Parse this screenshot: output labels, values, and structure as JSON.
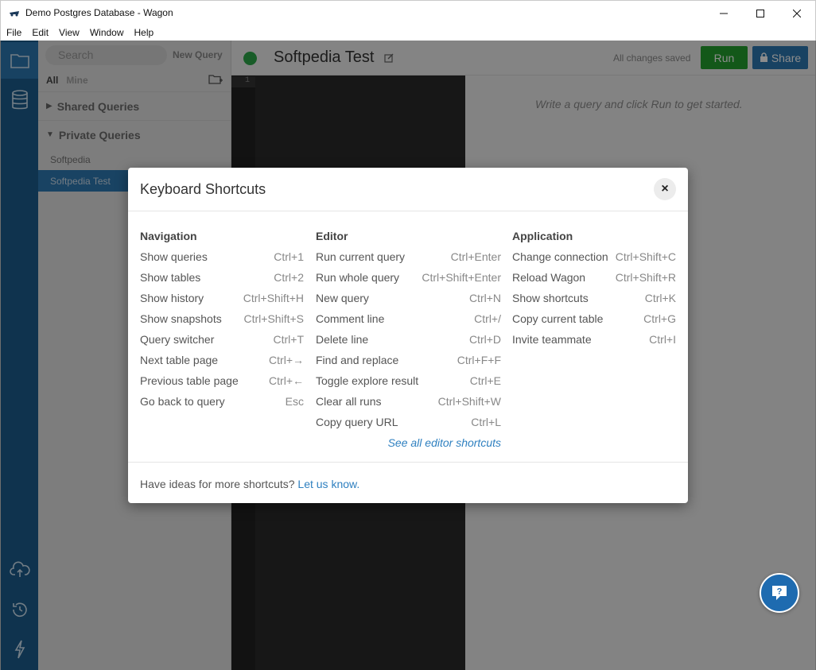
{
  "window": {
    "title": "Demo Postgres Database - Wagon"
  },
  "menu": [
    "File",
    "Edit",
    "View",
    "Window",
    "Help"
  ],
  "sidebar": {
    "search_placeholder": "Search",
    "new_query": "New Query",
    "filter_all": "All",
    "filter_mine": "Mine",
    "groups": [
      {
        "label": "Shared Queries",
        "expanded": false
      },
      {
        "label": "Private Queries",
        "expanded": true
      }
    ],
    "queries": [
      {
        "label": "Softpedia",
        "selected": false
      },
      {
        "label": "Softpedia Test",
        "selected": true
      }
    ]
  },
  "header": {
    "query_title": "Softpedia Test",
    "saved_status": "All changes saved",
    "run_label": "Run",
    "share_label": "Share",
    "status_color": "#2da84a"
  },
  "editor": {
    "line_number": "1"
  },
  "results": {
    "hint": "Write a query and click Run to get started."
  },
  "modal": {
    "title": "Keyboard Shortcuts",
    "close_label": "×",
    "navigation": {
      "title": "Navigation",
      "items": [
        {
          "label": "Show queries",
          "keys": "Ctrl+1"
        },
        {
          "label": "Show tables",
          "keys": "Ctrl+2"
        },
        {
          "label": "Show history",
          "keys": "Ctrl+Shift+H"
        },
        {
          "label": "Show snapshots",
          "keys": "Ctrl+Shift+S"
        },
        {
          "label": "Query switcher",
          "keys": "Ctrl+T"
        },
        {
          "label": "Next table page",
          "keys": "Ctrl+→"
        },
        {
          "label": "Previous table page",
          "keys": "Ctrl+←"
        },
        {
          "label": "Go back to query",
          "keys": "Esc"
        }
      ]
    },
    "editor": {
      "title": "Editor",
      "items": [
        {
          "label": "Run current query",
          "keys": "Ctrl+Enter"
        },
        {
          "label": "Run whole query",
          "keys": "Ctrl+Shift+Enter"
        },
        {
          "label": "New query",
          "keys": "Ctrl+N"
        },
        {
          "label": "Comment line",
          "keys": "Ctrl+/"
        },
        {
          "label": "Delete line",
          "keys": "Ctrl+D"
        },
        {
          "label": "Find and replace",
          "keys": "Ctrl+F+F"
        },
        {
          "label": "Toggle explore result",
          "keys": "Ctrl+E"
        },
        {
          "label": "Clear all runs",
          "keys": "Ctrl+Shift+W"
        },
        {
          "label": "Copy query URL",
          "keys": "Ctrl+L"
        }
      ],
      "see_all": "See all editor shortcuts"
    },
    "application": {
      "title": "Application",
      "items": [
        {
          "label": "Change connection",
          "keys": "Ctrl+Shift+C"
        },
        {
          "label": "Reload Wagon",
          "keys": "Ctrl+Shift+R"
        },
        {
          "label": "Show shortcuts",
          "keys": "Ctrl+K"
        },
        {
          "label": "Copy current table",
          "keys": "Ctrl+G"
        },
        {
          "label": "Invite teammate",
          "keys": "Ctrl+I"
        }
      ]
    },
    "footer_text": "Have ideas for more shortcuts?",
    "footer_link": "Let us know."
  },
  "icons": {
    "iconbar": [
      "folder-icon",
      "database-icon",
      "cloud-upload-icon",
      "history-icon",
      "lightning-icon"
    ],
    "help": "help-chat-icon"
  }
}
